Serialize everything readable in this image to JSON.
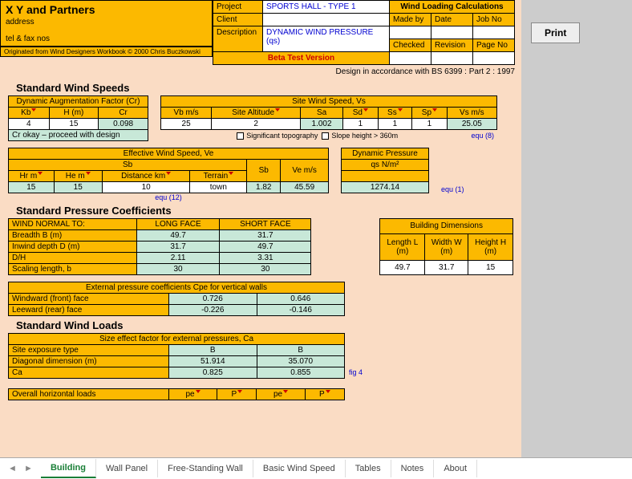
{
  "company": {
    "name": "X Y and Partners",
    "address": "address",
    "tel": "tel & fax nos"
  },
  "origin": "Originated from Wind Designers Workbook © 2000 Chris Buczkowski",
  "proj": {
    "project_lbl": "Project",
    "project_val": "SPORTS HALL - TYPE 1",
    "client_lbl": "Client",
    "client_val": "",
    "desc_lbl": "Description",
    "desc_val": "DYNAMIC WIND PRESSURE (qs)"
  },
  "calc": {
    "title": "Wind Loading Calculations",
    "made": "Made by",
    "date": "Date",
    "job": "Job No",
    "checked": "Checked",
    "rev": "Revision",
    "page": "Page No"
  },
  "beta": "Beta Test Version",
  "print": "Print",
  "design_note": "Design in accordance with BS 6399 : Part 2 : 1997",
  "sec1": "Standard Wind Speeds",
  "daf": {
    "title": "Dynamic Augmentation Factor (Cr)",
    "kb": "Kb",
    "hm": "H (m)",
    "cr": "Cr",
    "kb_v": "4",
    "hm_v": "15",
    "cr_v": "0.098",
    "msg": "Cr okay – proceed with design"
  },
  "sws": {
    "title": "Site Wind Speed, Vs",
    "vb": "Vb m/s",
    "alt": "Site Altitude",
    "sa": "Sa",
    "sd": "Sd",
    "ss": "Ss",
    "sp": "Sp",
    "vs": "Vs m/s",
    "vb_v": "25",
    "alt_v": "2",
    "sa_v": "1.002",
    "sd_v": "1",
    "ss_v": "1",
    "sp_v": "1",
    "vs_v": "25.05",
    "chk1": "Significant topography",
    "chk2": "Slope height > 360m",
    "equ": "equ (8)"
  },
  "ews": {
    "title": "Effective Wind Speed, Ve",
    "sb": "Sb",
    "hr": "Hr m",
    "he": "He m",
    "dist": "Distance km",
    "ter": "Terrain",
    "sb2": "Sb",
    "ve": "Ve m/s",
    "hr_v": "15",
    "he_v": "15",
    "dist_v": "10",
    "ter_v": "town",
    "sb_v": "1.82",
    "ve_v": "45.59",
    "equ": "equ (12)"
  },
  "dp": {
    "title": "Dynamic Pressure",
    "qs": "qs N/m²",
    "qs_v": "1274.14",
    "equ": "equ (1)"
  },
  "sec2": "Standard Pressure Coefficients",
  "wnt": {
    "title": "WIND NORMAL TO:",
    "lf": "LONG FACE",
    "sf": "SHORT FACE",
    "r1": "Breadth B (m)",
    "r1a": "49.7",
    "r1b": "31.7",
    "r2": "Inwind depth D (m)",
    "r2a": "31.7",
    "r2b": "49.7",
    "r3": "D/H",
    "r3a": "2.11",
    "r3b": "3.31",
    "r4": "Scaling length, b",
    "r4a": "30",
    "r4b": "30"
  },
  "bd": {
    "title": "Building Dimensions",
    "l": "Length L (m)",
    "w": "Width W (m)",
    "h": "Height H (m)",
    "lv": "49.7",
    "wv": "31.7",
    "hv": "15"
  },
  "cpe": {
    "title": "External pressure coefficients Cpe for vertical walls",
    "r1": "Windward (front) face",
    "r1a": "0.726",
    "r1b": "0.646",
    "r2": "Leeward (rear) face",
    "r2a": "-0.226",
    "r2b": "-0.146"
  },
  "sec3": "Standard Wind Loads",
  "sef": {
    "title": "Size effect factor for external pressures, Ca",
    "r1": "Site exposure type",
    "r1a": "B",
    "r1b": "B",
    "r2": "Diagonal dimension (m)",
    "r2a": "51.914",
    "r2b": "35.070",
    "r3": "Ca",
    "r3a": "0.825",
    "r3b": "0.855",
    "fig": "fig 4"
  },
  "ohl": {
    "title": "Overall horizontal loads",
    "pe": "pe",
    "p": "P"
  },
  "tabs": {
    "t1": "Building",
    "t2": "Wall Panel",
    "t3": "Free-Standing Wall",
    "t4": "Basic Wind Speed",
    "t5": "Tables",
    "t6": "Notes",
    "t7": "About"
  }
}
